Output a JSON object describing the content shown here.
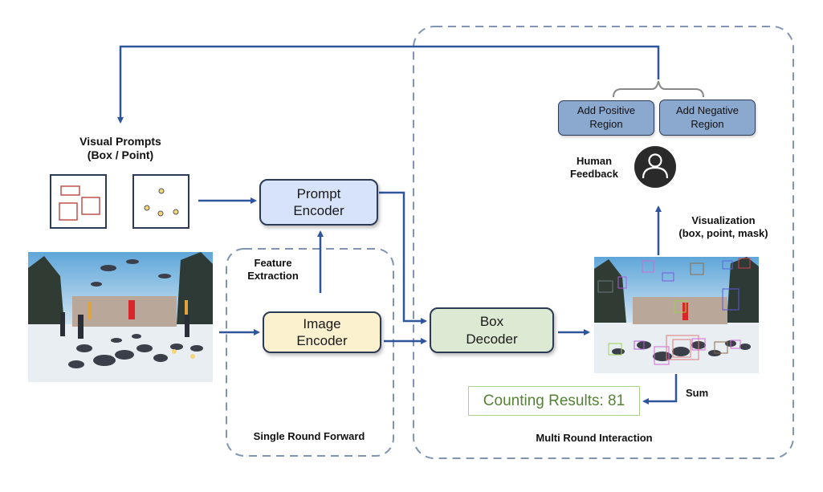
{
  "visual_prompts": {
    "title_line1": "Visual Prompts",
    "title_line2": "(Box / Point)"
  },
  "nodes": {
    "prompt_encoder": {
      "line1": "Prompt",
      "line2": "Encoder"
    },
    "image_encoder": {
      "line1": "Image",
      "line2": "Encoder"
    },
    "box_decoder": {
      "line1": "Box",
      "line2": "Decoder"
    }
  },
  "labels": {
    "feature_extraction_line1": "Feature",
    "feature_extraction_line2": "Extraction",
    "human_feedback_line1": "Human",
    "human_feedback_line2": "Feedback",
    "visualization_line1": "Visualization",
    "visualization_line2": "(box, point, mask)",
    "sum": "Sum",
    "single_round": "Single Round Forward",
    "multi_round": "Multi Round Interaction"
  },
  "feedback_buttons": {
    "positive": {
      "line1": "Add Positive",
      "line2": "Region"
    },
    "negative": {
      "line1": "Add Negative",
      "line2": "Region"
    }
  },
  "result": {
    "text": "Counting Results: 81"
  },
  "images": {
    "input": "pigeons-in-snowy-town-square",
    "output": "pigeons-with-detection-boxes"
  },
  "colors": {
    "arrow": "#2f559a",
    "dashed_border": "#8095b3",
    "box_prompt_red": "#c0504d",
    "point_yellow": "#f5d77a",
    "prompt_encoder_fill": "#d6e3fb",
    "image_encoder_fill": "#fbf1cf",
    "box_decoder_fill": "#dce9d3",
    "feedback_fill": "#8ba9cf",
    "result_green": "#548235"
  }
}
